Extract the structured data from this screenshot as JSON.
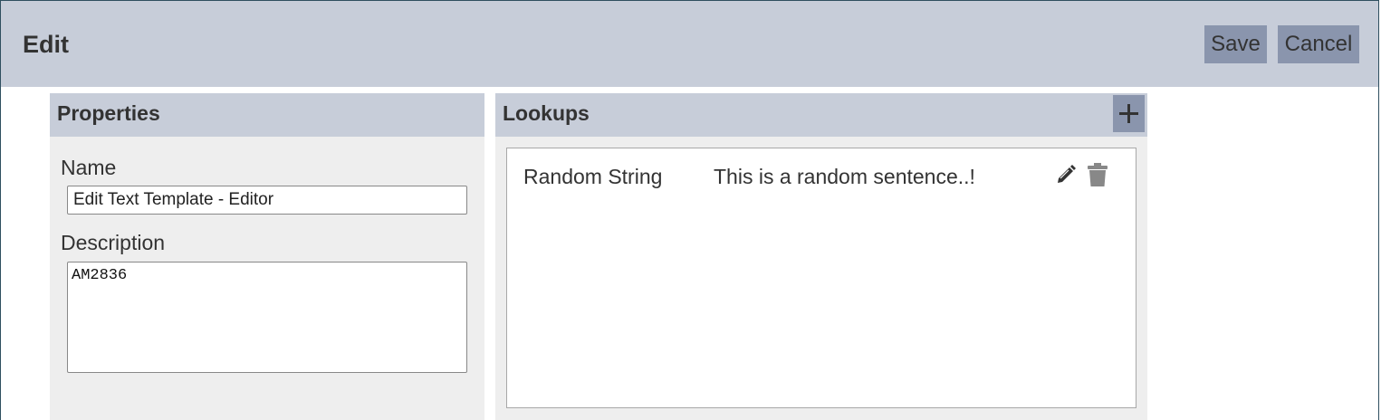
{
  "header": {
    "title": "Edit",
    "save_label": "Save",
    "cancel_label": "Cancel"
  },
  "properties": {
    "title": "Properties",
    "name_label": "Name",
    "name_value": "Edit Text Template - Editor",
    "description_label": "Description",
    "description_value": "AM2836"
  },
  "lookups": {
    "title": "Lookups",
    "add_icon": "plus-icon",
    "items": [
      {
        "name": "Random String",
        "value": "This is a random sentence..!",
        "edit_icon": "pencil-icon",
        "delete_icon": "trash-icon"
      }
    ]
  },
  "colors": {
    "header_bg": "#c7cdd9",
    "button_bg": "#8a95ad",
    "panel_bg": "#eeeeee",
    "frame_border": "#2f4f5f"
  }
}
